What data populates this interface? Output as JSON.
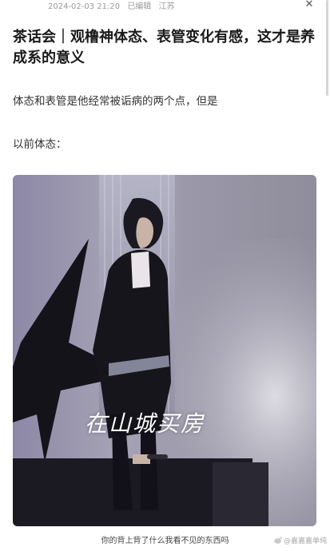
{
  "article": {
    "meta": {
      "date": "2024-02-03 21:20",
      "edited": "已编辑",
      "location": "江苏"
    },
    "title": "茶话会｜观橹神体态、表管变化有感，这才是养成系的意义",
    "paragraphs": [
      "体态和表管是他经常被诟病的两个点，但是",
      "以前体态："
    ],
    "image": {
      "overlay_text": "在山城买房",
      "subtitle": "你的背上背了什么我看不见的东西吗",
      "watermark": "@嘉嘉嘉单纯"
    }
  },
  "icons": {
    "close": "close-icon",
    "weibo": "weibo-icon"
  },
  "colors": {
    "title": "#1a1a1a",
    "meta": "#9a9a9a",
    "stage_bg": "#9a97a8"
  }
}
